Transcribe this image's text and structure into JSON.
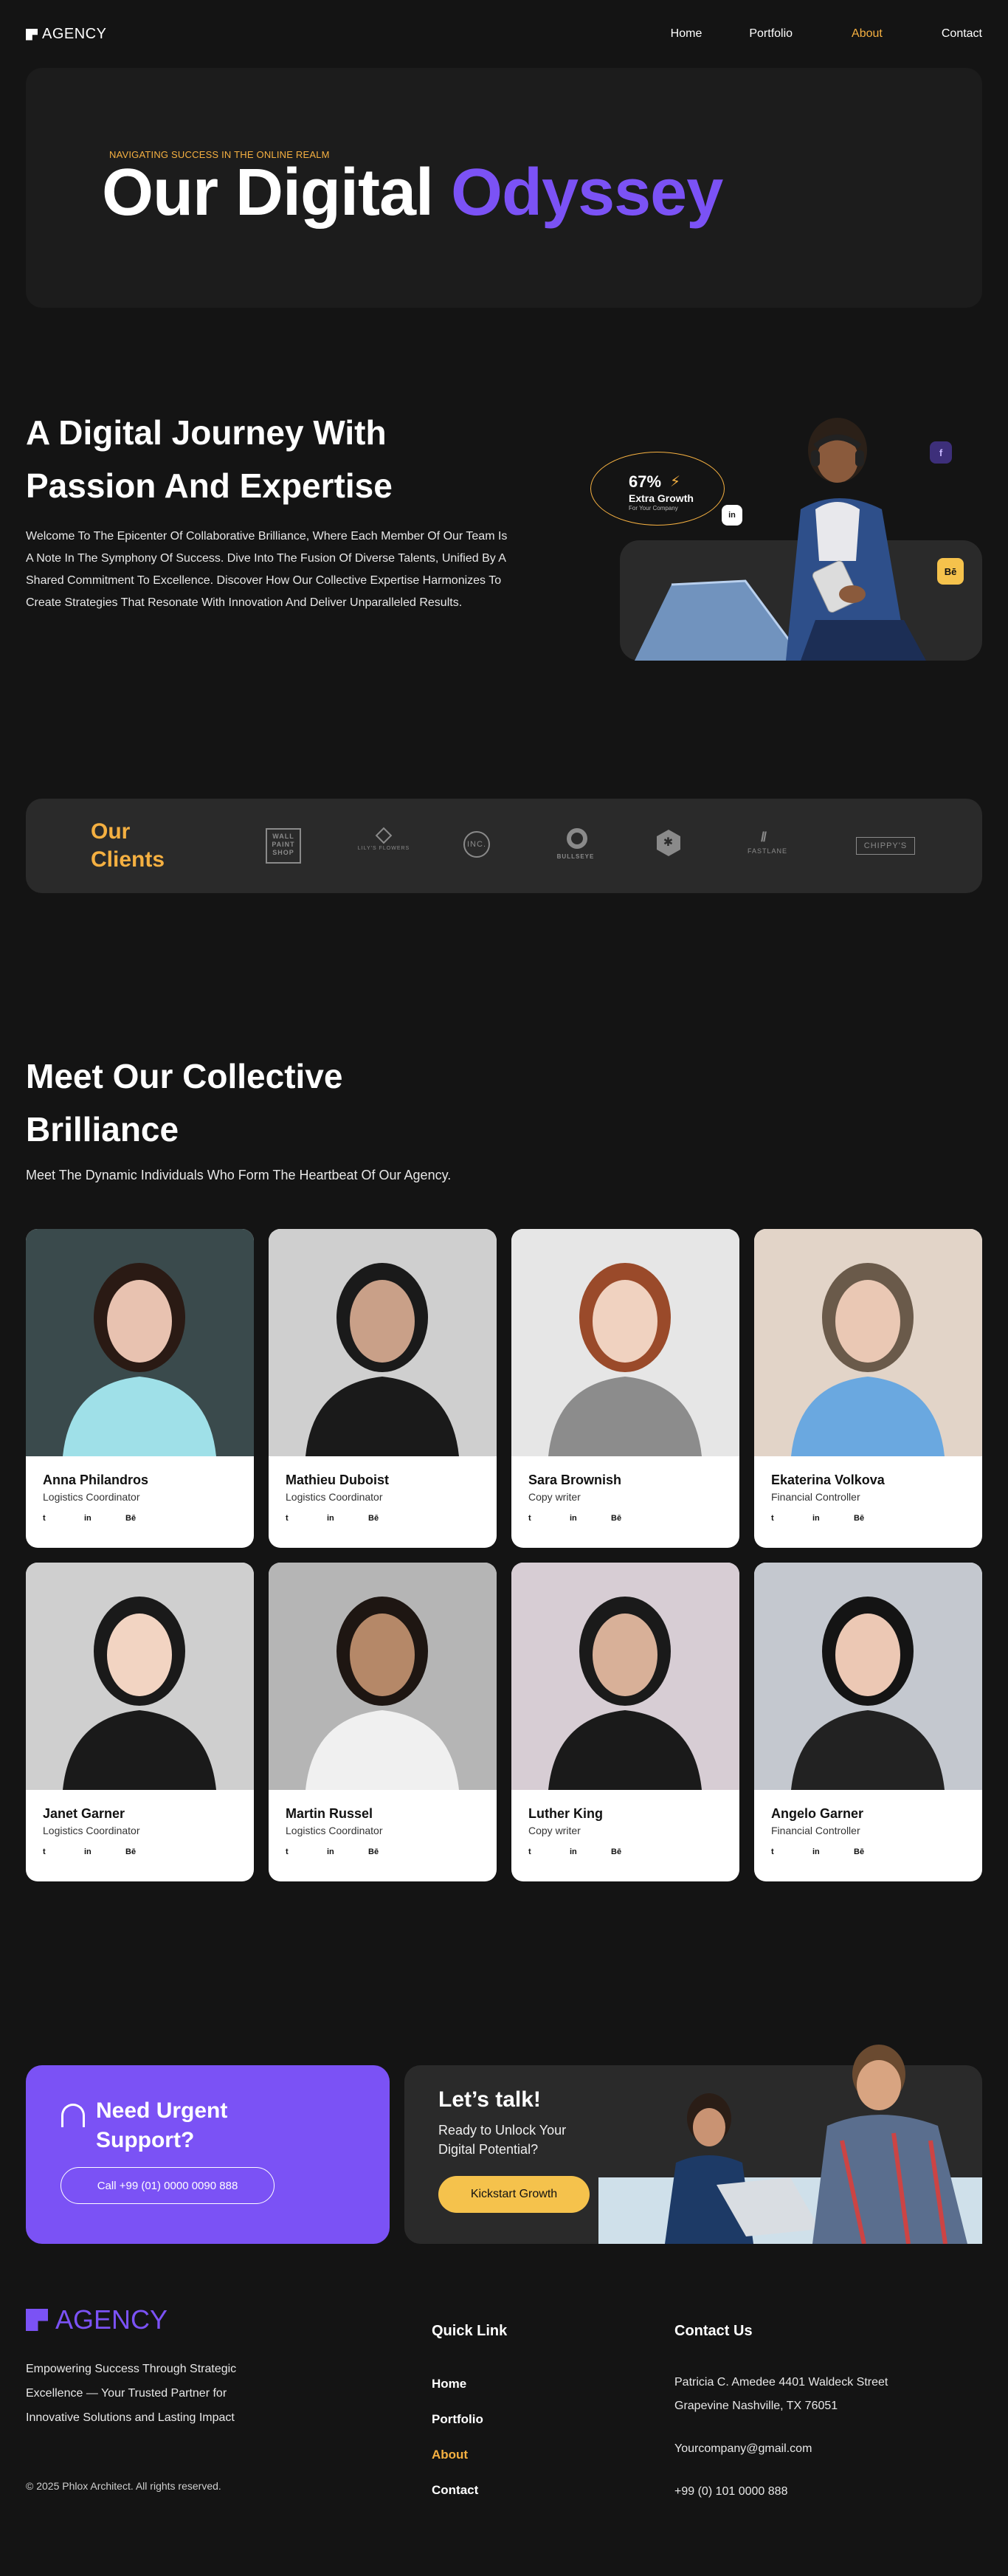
{
  "nav": {
    "logo": "AGENCY",
    "links": [
      "Home",
      "Portfolio",
      "About",
      "Contact"
    ],
    "active": "About"
  },
  "hero": {
    "kicker": "NAVIGATING SUCCESS IN THE ONLINE REALM",
    "title_plain": "Our Digital ",
    "title_accent": "Odyssey"
  },
  "journey": {
    "title": "A Digital Journey With Passion And Expertise",
    "text": "Welcome To The Epicenter Of Collaborative Brilliance, Where Each Member Of Our Team Is A Note In The Symphony Of Success. Dive Into The Fusion Of Diverse Talents, Unified By A Shared Commitment To Excellence. Discover How Our Collective Expertise Harmonizes To Create Strategies That Resonate With Innovation And Deliver Unparalleled Results.",
    "growth_pct": "67%",
    "growth_label": "Extra Growth",
    "growth_sub": "For Your Company",
    "badges": {
      "facebook": "f",
      "linkedin": "in",
      "behance": "Bē"
    }
  },
  "clients": {
    "title": "Our Clients",
    "logos": [
      "WALL PAINT SHOP",
      "LILY'S FLOWERS",
      "INC.",
      "BULLSEYE",
      "✱",
      "FASTLANE",
      "CHIPPY'S"
    ]
  },
  "team": {
    "title": "Meet Our Collective Brilliance",
    "subtitle": "Meet The Dynamic Individuals Who Form The Heartbeat Of Our Agency.",
    "social": [
      "t",
      "in",
      "Bē"
    ],
    "members": [
      {
        "name": "Anna Philandros",
        "role": "Logistics Coordinator"
      },
      {
        "name": "Mathieu Duboist",
        "role": "Logistics Coordinator"
      },
      {
        "name": "Sara Brownish",
        "role": "Copy writer"
      },
      {
        "name": "Ekaterina Volkova",
        "role": "Financial Controller"
      },
      {
        "name": "Janet Garner",
        "role": "Logistics Coordinator"
      },
      {
        "name": "Martin Russel",
        "role": "Logistics Coordinator"
      },
      {
        "name": "Luther King",
        "role": "Copy writer"
      },
      {
        "name": "Angelo Garner",
        "role": "Financial Controller"
      }
    ]
  },
  "cta": {
    "urgent_title": "Need Urgent Support?",
    "urgent_button": "Call +99 (01) 0000 0090 888",
    "talk_title": "Let’s talk!",
    "talk_sub": "Ready to Unlock Your Digital Potential?",
    "talk_button": "Kickstart Growth"
  },
  "footer": {
    "logo": "AGENCY",
    "description": "Empowering Success Through Strategic Excellence — Your Trusted Partner for Innovative Solutions and Lasting Impact",
    "copyright": "© 2025 Phlox Architect. All rights reserved.",
    "quick_title": "Quick Link",
    "quick_links": [
      "Home",
      "Portfolio",
      "About",
      "Contact"
    ],
    "contact_title": "Contact Us",
    "address": "Patricia C. Amedee 4401 Waldeck Street Grapevine Nashville, TX 76051",
    "email": "Yourcompany@gmail.com",
    "phone": "+99 (0) 101 0000 888"
  },
  "colors": {
    "background": "#141414",
    "panel": "#1c1c1c",
    "accent_purple": "#7b52f5",
    "accent_yellow": "#f5b041"
  }
}
